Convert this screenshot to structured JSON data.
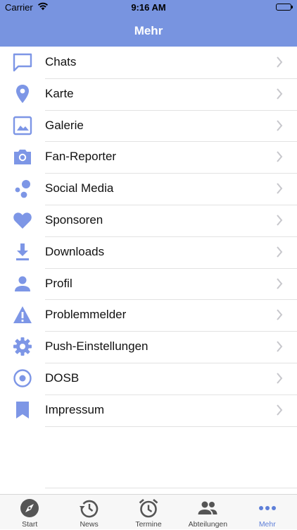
{
  "status_bar": {
    "carrier": "Carrier",
    "time": "9:16 AM"
  },
  "nav": {
    "title": "Mehr"
  },
  "colors": {
    "accent": "#7894e0",
    "icon": "#7d96e6",
    "tab_inactive": "#555555",
    "tab_active": "#5e7fd8"
  },
  "menu": {
    "items": [
      {
        "label": "Chats",
        "icon": "chat-bubble-icon"
      },
      {
        "label": "Karte",
        "icon": "map-pin-icon"
      },
      {
        "label": "Galerie",
        "icon": "image-icon"
      },
      {
        "label": "Fan-Reporter",
        "icon": "camera-icon"
      },
      {
        "label": "Social Media",
        "icon": "bubbles-icon"
      },
      {
        "label": "Sponsoren",
        "icon": "heart-icon"
      },
      {
        "label": "Downloads",
        "icon": "download-icon"
      },
      {
        "label": "Profil",
        "icon": "person-icon"
      },
      {
        "label": "Problemmelder",
        "icon": "warning-icon"
      },
      {
        "label": "Push-Einstellungen",
        "icon": "gear-icon"
      },
      {
        "label": "DOSB",
        "icon": "record-icon"
      },
      {
        "label": "Impressum",
        "icon": "bookmark-icon"
      }
    ]
  },
  "tabs": [
    {
      "label": "Start",
      "icon": "compass-icon",
      "active": false
    },
    {
      "label": "News",
      "icon": "history-icon",
      "active": false
    },
    {
      "label": "Termine",
      "icon": "alarm-clock-icon",
      "active": false
    },
    {
      "label": "Abteilungen",
      "icon": "group-icon",
      "active": false
    },
    {
      "label": "Mehr",
      "icon": "more-dots-icon",
      "active": true
    }
  ]
}
